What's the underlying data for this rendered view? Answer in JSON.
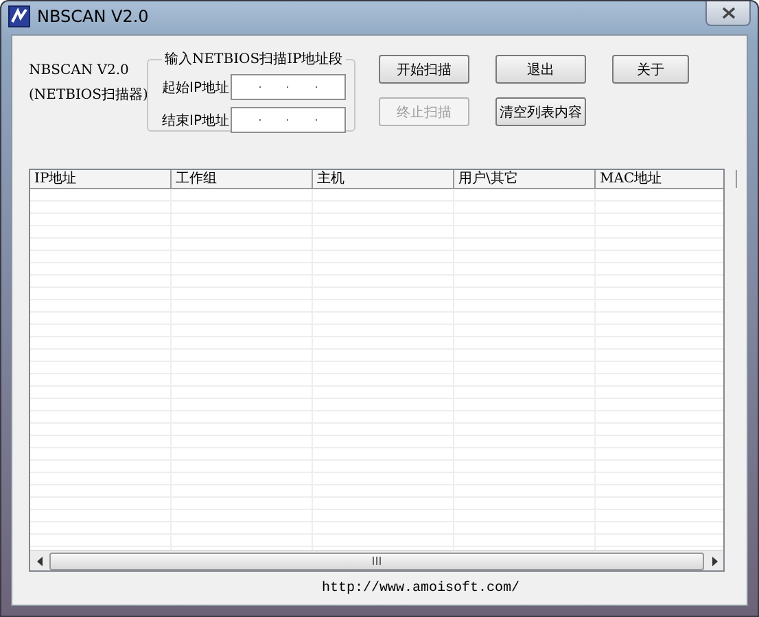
{
  "window": {
    "title": "NBSCAN V2.0"
  },
  "about": {
    "lines": [
      "NBSCAN V2.0",
      "(NETBIOS扫描器)"
    ]
  },
  "ip_range": {
    "title": "输入NETBIOS扫描IP地址段",
    "fields": [
      {
        "label": "起始IP地址"
      },
      {
        "label": "结束IP地址"
      }
    ]
  },
  "buttons": [
    {
      "label": "开始扫描",
      "disabled": false
    },
    {
      "label": "退出",
      "disabled": false
    },
    {
      "label": "关于",
      "disabled": false
    },
    {
      "label": "终止扫描",
      "disabled": true
    },
    {
      "label": "清空列表内容",
      "disabled": false
    }
  ],
  "table": {
    "columns": [
      "IP地址",
      "工作组",
      "主机",
      "用户\\其它",
      "MAC地址"
    ]
  },
  "footer": {
    "url": "http://www.amoisoft.com/"
  }
}
